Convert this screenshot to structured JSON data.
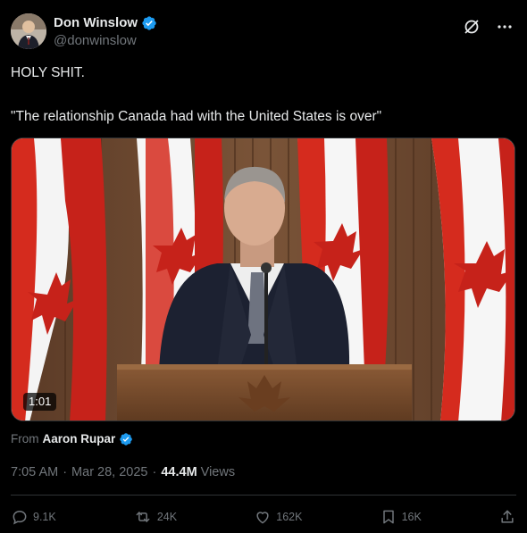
{
  "author": {
    "display_name": "Don Winslow",
    "handle": "@donwinslow",
    "verified": true,
    "avatar_icon": "avatar-photo"
  },
  "header_actions": {
    "grok_icon": "slash-circle-icon",
    "more_icon": "more-dots-icon"
  },
  "tweet": {
    "line1": "HOLY SHIT.",
    "line2": "\"The relationship Canada had with the United States is over\""
  },
  "media": {
    "duration": "1:01"
  },
  "source": {
    "from_label": "From",
    "from_name": "Aaron Rupar"
  },
  "meta": {
    "time": "7:05 AM",
    "dot1": "·",
    "date": "Mar 28, 2025",
    "dot2": "·",
    "views_count": "44.4M",
    "views_label": "Views"
  },
  "actions": {
    "reply_count": "9.1K",
    "repost_count": "24K",
    "like_count": "162K",
    "bookmark_count": "16K"
  },
  "colors": {
    "background": "#000000",
    "text_primary": "#e7e9ea",
    "text_secondary": "#71767b",
    "verified_blue": "#1d9bf0",
    "divider": "#2f3336",
    "flag_red": "#d52b1e"
  }
}
